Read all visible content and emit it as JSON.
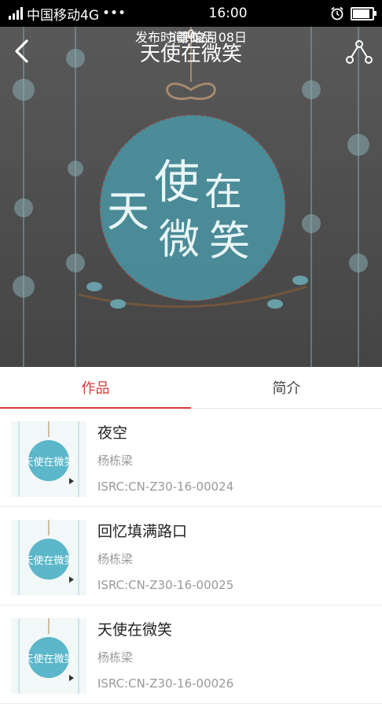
{
  "status": {
    "carrier": "中国移动4G",
    "signal_icon": "signal-icon",
    "dots": "•••",
    "time": "16:00",
    "battery_level": 0.9
  },
  "header": {
    "title": "天使在微笑"
  },
  "cover": {
    "badge_text": "天使在微笑",
    "logo_chars": [
      "天",
      "使",
      "在",
      "微",
      "笑"
    ]
  },
  "album": {
    "publish_label": "发布时间:12月08日",
    "works_count": "3首作品",
    "comment_count": "0",
    "comment_label": "评论"
  },
  "tabs": [
    {
      "label": "作品",
      "active": true
    },
    {
      "label": "简介",
      "active": false
    }
  ],
  "tracks": [
    {
      "name": "夜空",
      "artist": "杨栋梁",
      "isrc": "ISRC:CN-Z30-16-00024"
    },
    {
      "name": "回忆填满路口",
      "artist": "杨栋梁",
      "isrc": "ISRC:CN-Z30-16-00025"
    },
    {
      "name": "天使在微笑",
      "artist": "杨栋梁",
      "isrc": "ISRC:CN-Z30-16-00026"
    }
  ],
  "colors": {
    "accent": "#d83a3a",
    "cover_teal": "#5bb7c9"
  }
}
